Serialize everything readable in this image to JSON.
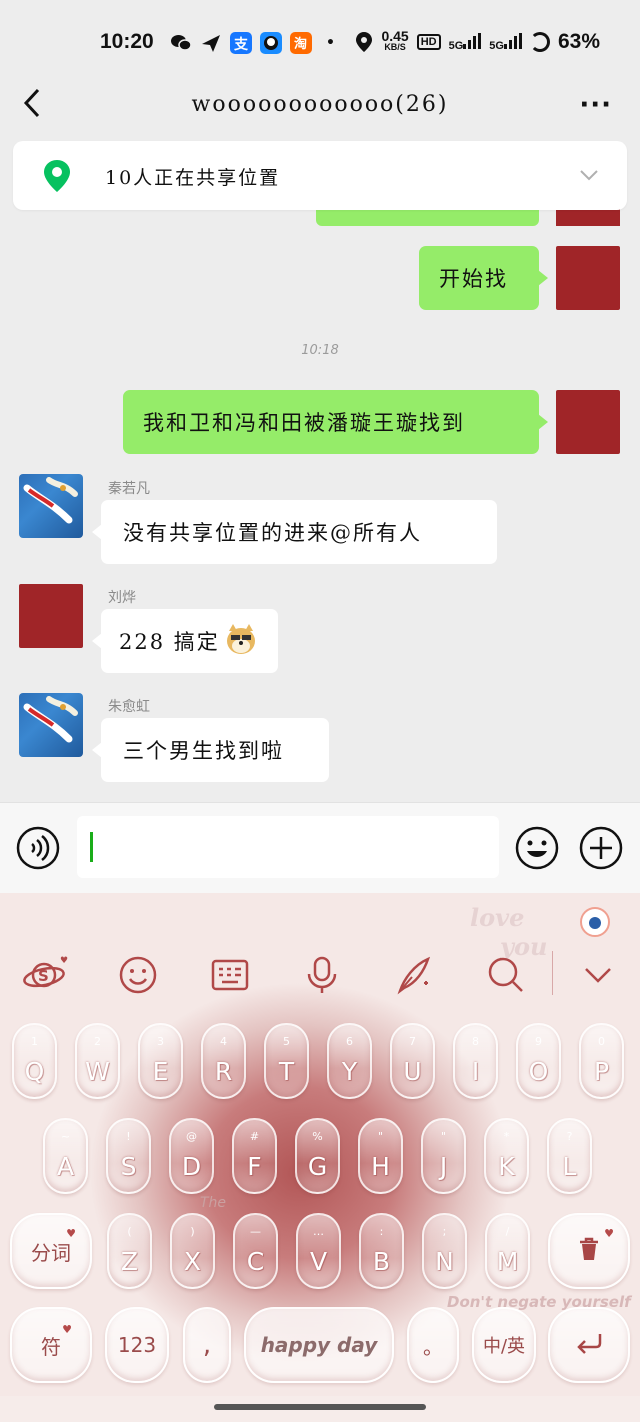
{
  "status_bar": {
    "time": "10:20",
    "net_speed_value": "0.45",
    "net_speed_unit": "KB/S",
    "hd_label": "HD",
    "signal1_label": "5G",
    "signal2_label": "5G",
    "battery": "63%",
    "app_icons": [
      "wechat-icon",
      "send-icon",
      "alipay-icon",
      "bird-app-icon",
      "taobao-icon"
    ]
  },
  "header": {
    "title": "woooooooooooo(26)",
    "back_icon": "chevron-left-icon",
    "more_label": "···"
  },
  "share_location": {
    "text": "10人正在共享位置",
    "icon": "location-pin-icon",
    "pin_color": "#07c160"
  },
  "messages": {
    "m1": {
      "text": "开始找",
      "from": "me"
    },
    "timestamp": "10:18",
    "m2": {
      "text": "我和卫和冯和田被潘璇王璇找到",
      "from": "me"
    },
    "m3": {
      "sender": "秦若凡",
      "text": "没有共享位置的进来@所有人"
    },
    "m4": {
      "sender": "刘烨",
      "text": "228 搞定",
      "emoji": "doge-emoji"
    },
    "m5": {
      "sender": "朱愈虹",
      "text": "三个男生找到啦"
    }
  },
  "input_bar": {
    "value": "",
    "voice_icon": "voice-icon",
    "emoji_icon": "emoji-icon",
    "plus_icon": "plus-icon"
  },
  "keyboard": {
    "toolbar": [
      "skin-icon",
      "emoji-face-icon",
      "keyboard-icon",
      "mic-icon",
      "handwriting-icon",
      "search-icon",
      "collapse-icon"
    ],
    "deco_love": "love",
    "deco_you": "you",
    "deco_bottom": "Don't negate yourself",
    "deco_the": "The",
    "row1": [
      {
        "sub": "1",
        "main": "Q"
      },
      {
        "sub": "2",
        "main": "W"
      },
      {
        "sub": "3",
        "main": "E"
      },
      {
        "sub": "4",
        "main": "R"
      },
      {
        "sub": "5",
        "main": "T"
      },
      {
        "sub": "6",
        "main": "Y"
      },
      {
        "sub": "7",
        "main": "U"
      },
      {
        "sub": "8",
        "main": "I"
      },
      {
        "sub": "9",
        "main": "O"
      },
      {
        "sub": "0",
        "main": "P"
      }
    ],
    "row2": [
      {
        "sub": "~",
        "main": "A"
      },
      {
        "sub": "!",
        "main": "S"
      },
      {
        "sub": "@",
        "main": "D"
      },
      {
        "sub": "#",
        "main": "F"
      },
      {
        "sub": "%",
        "main": "G"
      },
      {
        "sub": "\"",
        "main": "H"
      },
      {
        "sub": "\"",
        "main": "J"
      },
      {
        "sub": "*",
        "main": "K"
      },
      {
        "sub": "?",
        "main": "L"
      }
    ],
    "row3": [
      {
        "sub": "(",
        "main": "Z"
      },
      {
        "sub": ")",
        "main": "X"
      },
      {
        "sub": "—",
        "main": "C"
      },
      {
        "sub": "…",
        "main": "V"
      },
      {
        "sub": ":",
        "main": "B"
      },
      {
        "sub": ";",
        "main": "N"
      },
      {
        "sub": "/",
        "main": "M"
      }
    ],
    "segment_label": "分词",
    "symbol_label": "符",
    "num_label": "123",
    "comma_label": ",",
    "space_label": "happy day",
    "period_label": "。",
    "lang_label": "中/英",
    "enter_icon": "enter-icon",
    "delete_icon": "trash-icon"
  }
}
